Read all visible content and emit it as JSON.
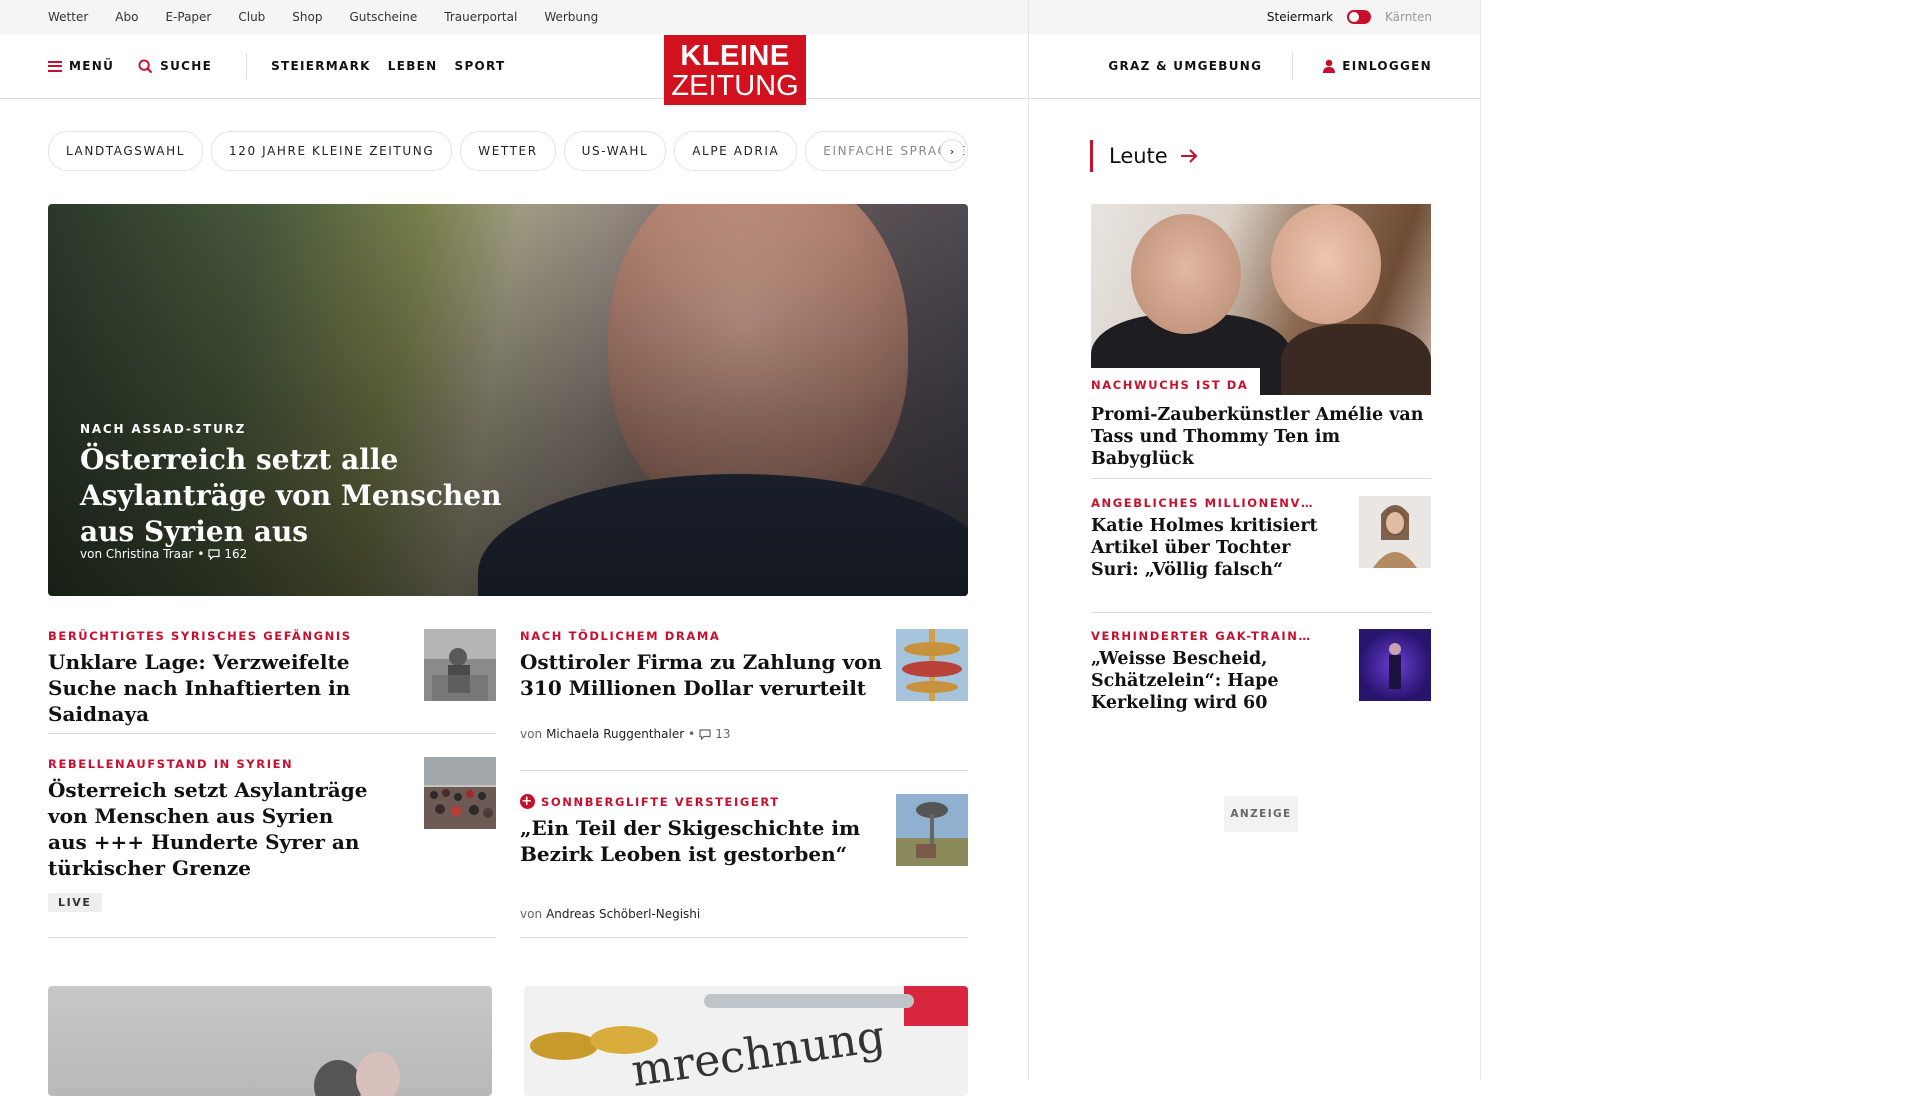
{
  "topbar": {
    "links": [
      "Wetter",
      "Abo",
      "E-Paper",
      "Club",
      "Shop",
      "Gutscheine",
      "Trauerportal",
      "Werbung"
    ],
    "region_active": "Steiermark",
    "region_inactive": "Kärnten"
  },
  "header": {
    "menu": "MENÜ",
    "search": "SUCHE",
    "sections": [
      "STEIERMARK",
      "LEBEN",
      "SPORT"
    ],
    "logo_line1": "KLEINE",
    "logo_line2": "ZEITUNG",
    "local": "GRAZ & UMGEBUNG",
    "login": "EINLOGGEN"
  },
  "tags": [
    "LANDTAGSWAHL",
    "120 JAHRE KLEINE ZEITUNG",
    "WETTER",
    "US-WAHL",
    "ALPE ADRIA",
    "EINFACHE SPRACHE"
  ],
  "hero": {
    "kicker": "NACH ASSAD-STURZ",
    "title": "Österreich setzt alle Asylanträge von Menschen aus Syrien aus",
    "author": "von Christina Traar",
    "comments": "162"
  },
  "articles": [
    {
      "kicker": "BERÜCHTIGTES SYRISCHES GEFÄNGNIS",
      "title": "Unklare Lage: Verzweifelte Suche nach Inhaftierten in Saidnaya"
    },
    {
      "kicker": "NACH TÖDLICHEM DRAMA",
      "title": "Osttiroler Firma zu Zahlung von 310 Millionen Dollar verurteilt",
      "author_prefix": "von",
      "author": "Michaela Ruggenthaler",
      "comments": "13"
    },
    {
      "kicker": "REBELLENAUFSTAND IN SYRIEN",
      "title": "Österreich setzt Asylanträge von Menschen aus Syrien aus +++ Hunderte Syrer an türkischer Grenze",
      "badge": "LIVE"
    },
    {
      "kicker": "SONNBERGLIFTE VERSTEIGERT",
      "title": "„Ein Teil der Skigeschichte im Bezirk Leoben ist gestorben“",
      "author_prefix": "von",
      "author": "Andreas Schöberl-Negishi"
    }
  ],
  "sidebar": {
    "title": "Leute",
    "main": {
      "kicker": "NACHWUCHS IST DA",
      "title": "Promi-Zauberkünstler Amélie van Tass und Thommy Ten im Babyglück"
    },
    "items": [
      {
        "kicker": "ANGEBLICHES MILLIONENV…",
        "title": "Katie Holmes kritisiert Artikel über Tochter Suri: „Völlig falsch“"
      },
      {
        "kicker": "VERHINDERTER GAK-TRAIN…",
        "title": "„Weisse Bescheid, Schätzelein“: Hape Kerkeling wird 60"
      }
    ],
    "ad": "ANZEIGE"
  },
  "colors": {
    "brand": "#d1111e",
    "accent": "#c8102e"
  }
}
